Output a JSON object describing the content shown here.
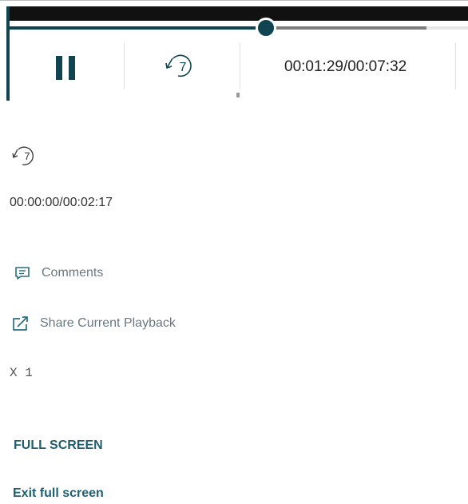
{
  "player": {
    "rewind_seconds": "7",
    "current_time": "00:01:29",
    "total_time": "00:07:32",
    "time_label": "00:01:29/00:07:32",
    "progress_fraction": 0.56,
    "buffered_fraction": 0.91,
    "colors": {
      "accent": "#0f4450",
      "video_background": "#111111",
      "buffer": "#7d7d7d",
      "rail": "#e6e6e6"
    },
    "icons": {
      "pause": "pause-icon",
      "rewind": "rewind-7-icon"
    }
  },
  "fallback": {
    "rewind_seconds": "7",
    "time_label": "00:00:00/00:02:17",
    "comments_label": "Comments",
    "share_label": "Share Current Playback",
    "speed_label": "X 1",
    "fullscreen_label": "FULL SCREEN",
    "exit_fullscreen_label": "Exit full screen",
    "colors": {
      "link_text": "#6b7780",
      "action_text": "#1f5f72"
    },
    "icons": {
      "comments": "comment-icon",
      "share": "share-icon",
      "rewind": "rewind-7-icon"
    }
  }
}
